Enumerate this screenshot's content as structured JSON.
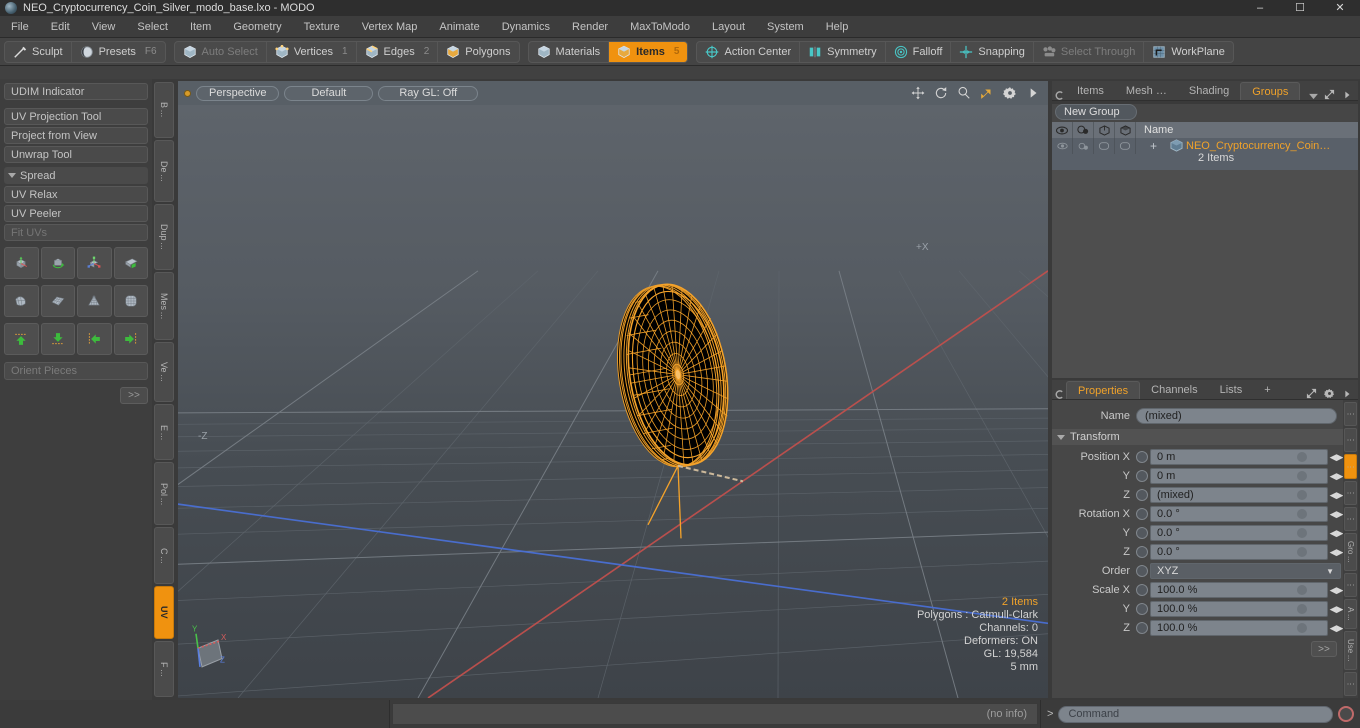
{
  "window": {
    "title": "NEO_Cryptocurrency_Coin_Silver_modo_base.lxo - MODO",
    "minimize": "–",
    "maximize": "☐",
    "close": "✕"
  },
  "menu": {
    "items": [
      "File",
      "Edit",
      "View",
      "Select",
      "Item",
      "Geometry",
      "Texture",
      "Vertex Map",
      "Animate",
      "Dynamics",
      "Render",
      "MaxToModo",
      "Layout",
      "System",
      "Help"
    ]
  },
  "modebar": {
    "group1": [
      {
        "label": "Sculpt",
        "icon": "brush-icon",
        "state": "normal",
        "count": ""
      },
      {
        "label": "Presets",
        "icon": "sphere-icon",
        "state": "normal",
        "count": "F6"
      }
    ],
    "group2": [
      {
        "label": "Auto Select",
        "icon": "cube-icon",
        "state": "dim",
        "count": ""
      },
      {
        "label": "Vertices",
        "icon": "cube-vertex-icon",
        "state": "normal",
        "count": "1"
      },
      {
        "label": "Edges",
        "icon": "cube-edge-icon",
        "state": "normal",
        "count": "2"
      },
      {
        "label": "Polygons",
        "icon": "cube-polygon-icon",
        "state": "normal",
        "count": ""
      }
    ],
    "group3": [
      {
        "label": "Materials",
        "icon": "cube-material-icon",
        "state": "normal",
        "count": ""
      },
      {
        "label": "Items",
        "icon": "cube-item-icon",
        "state": "active",
        "count": "5"
      }
    ],
    "group4": [
      {
        "label": "Action Center",
        "icon": "action-center-icon",
        "state": "normal",
        "count": ""
      },
      {
        "label": "Symmetry",
        "icon": "symmetry-icon",
        "state": "normal",
        "count": ""
      },
      {
        "label": "Falloff",
        "icon": "falloff-icon",
        "state": "normal",
        "count": ""
      },
      {
        "label": "Snapping",
        "icon": "snapping-icon",
        "state": "normal",
        "count": ""
      },
      {
        "label": "Select Through",
        "icon": "select-through-icon",
        "state": "dim",
        "count": ""
      },
      {
        "label": "WorkPlane",
        "icon": "workplane-icon",
        "state": "normal",
        "count": ""
      }
    ]
  },
  "left_panel": {
    "buttons_top": [
      {
        "label": "UDIM Indicator",
        "state": "normal"
      }
    ],
    "buttons_mid": [
      {
        "label": "UV Projection Tool",
        "state": "normal"
      },
      {
        "label": "Project from View",
        "state": "normal"
      },
      {
        "label": "Unwrap Tool",
        "state": "normal"
      }
    ],
    "section": "Spread",
    "buttons_low": [
      {
        "label": "UV Relax",
        "state": "normal"
      },
      {
        "label": "UV Peeler",
        "state": "normal"
      },
      {
        "label": "Fit UVs",
        "state": "dim"
      }
    ],
    "icon_row_1": [
      "move-uv-icon",
      "rotate-uv-icon",
      "scale-uv-icon",
      "flip-uv-icon"
    ],
    "icon_row_2": [
      "shrinkwrap-icon",
      "uv-grid-icon",
      "cone-unwrap-icon",
      "sphere-unwrap-icon"
    ],
    "icon_row_3": [
      "align-up-icon",
      "align-down-icon",
      "align-left-icon",
      "align-right-icon"
    ],
    "orient_field": "Orient Pieces",
    "more_button": ">>",
    "vtabs": [
      {
        "label": "B ...",
        "active": false
      },
      {
        "label": "De ...",
        "active": false
      },
      {
        "label": "Dup ...",
        "active": false
      },
      {
        "label": "Mes ...",
        "active": false
      },
      {
        "label": "Ve ...",
        "active": false
      },
      {
        "label": "E ...",
        "active": false
      },
      {
        "label": "Pol ...",
        "active": false
      },
      {
        "label": "C ...",
        "active": false
      },
      {
        "label": "UV",
        "active": true
      },
      {
        "label": "F ...",
        "active": false
      }
    ]
  },
  "viewport": {
    "header": {
      "projection": "Perspective",
      "style": "Default",
      "raygl": "Ray GL: Off",
      "icons": [
        "move-view-icon",
        "rotate-view-icon",
        "zoom-view-icon",
        "fit-view-icon",
        "gear-icon",
        "chevron-right-icon"
      ]
    },
    "axis_labels": {
      "minus_z": "-Z",
      "plus_x": "+X",
      "gizmo_y": "Y",
      "gizmo_x": "X",
      "gizmo_z": "Z"
    },
    "hud": {
      "items": "2 Items",
      "polygons": "Polygons : Catmull-Clark",
      "channels": "Channels: 0",
      "deformers": "Deformers: ON",
      "gl": "GL: 19,584",
      "scale": "5 mm"
    },
    "colors": {
      "x_axis": "#c0504d",
      "z_axis": "#4a6fd4",
      "wireframe": "#f5a32a",
      "background_top": "#5b6168",
      "background_bottom": "#41464b"
    }
  },
  "right_panel": {
    "tabs": [
      {
        "label": "Items",
        "active": false
      },
      {
        "label": "Mesh …",
        "active": false
      },
      {
        "label": "Shading",
        "active": false
      },
      {
        "label": "Groups",
        "active": true
      }
    ],
    "tab_overflow": "chevron-down-icon",
    "new_group_button": "New Group",
    "list_columns": [
      "eye-icon",
      "render-icon",
      "wire-icon",
      "shade-icon",
      "Name"
    ],
    "list_header_name": "Name",
    "rows": [
      {
        "name": "NEO_Cryptocurrency_Coin…",
        "sub": "2 Items",
        "expand": "+"
      }
    ]
  },
  "properties": {
    "tabs": [
      {
        "label": "Properties",
        "active": true
      },
      {
        "label": "Channels",
        "active": false
      },
      {
        "label": "Lists",
        "active": false
      },
      {
        "label": "+",
        "active": false
      }
    ],
    "name_label": "Name",
    "name_value": "(mixed)",
    "section": "Transform",
    "fields": [
      {
        "label": "Position X",
        "value": "0 m"
      },
      {
        "label": "Y",
        "value": "0 m"
      },
      {
        "label": "Z",
        "value": "(mixed)"
      },
      {
        "label": "Rotation X",
        "value": "0.0 °"
      },
      {
        "label": "Y",
        "value": "0.0 °"
      },
      {
        "label": "Z",
        "value": "0.0 °"
      }
    ],
    "order_label": "Order",
    "order_value": "XYZ",
    "scale_fields": [
      {
        "label": "Scale X",
        "value": "100.0 %"
      },
      {
        "label": "Y",
        "value": "100.0 %"
      },
      {
        "label": "Z",
        "value": "100.0 %"
      }
    ],
    "more_button": ">>",
    "vtabs": [
      {
        "label": "⋮",
        "active": false
      },
      {
        "label": "⋮",
        "active": false
      },
      {
        "label": "⋮",
        "active": true
      },
      {
        "label": "⋮",
        "active": false
      },
      {
        "label": "⋮",
        "active": false
      },
      {
        "label": "Gro ...",
        "active": false
      },
      {
        "label": "⋮",
        "active": false
      },
      {
        "label": "A ...",
        "active": false
      },
      {
        "label": "Use ...",
        "active": false
      },
      {
        "label": "⋮",
        "active": false
      }
    ]
  },
  "statusbar": {
    "info": "(no info)",
    "command_prompt": ">",
    "command_placeholder": "Command",
    "record_icon": "record-icon"
  }
}
